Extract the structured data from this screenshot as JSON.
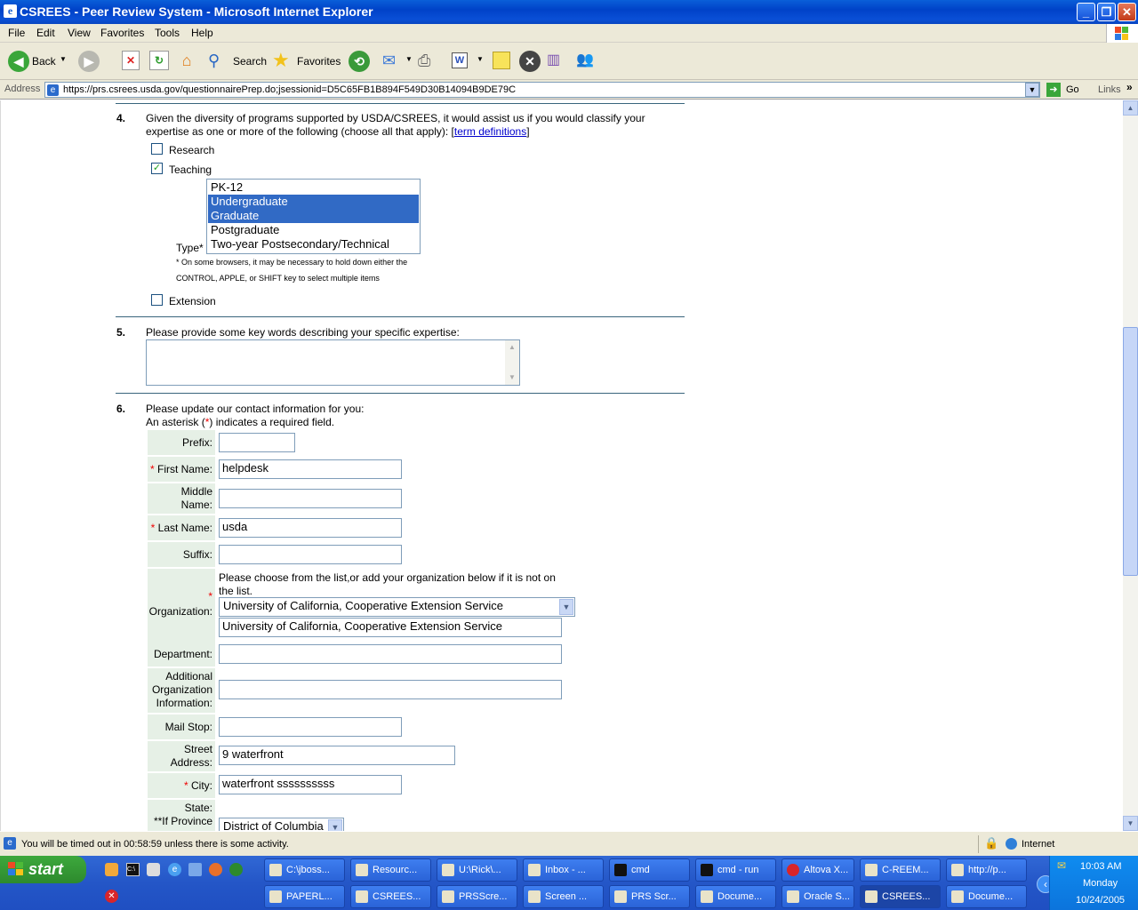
{
  "window": {
    "title": "CSREES - Peer Review System - Microsoft Internet Explorer",
    "app_icon_glyph": "e"
  },
  "menu": [
    "File",
    "Edit",
    "View",
    "Favorites",
    "Tools",
    "Help"
  ],
  "toolbar": {
    "back": "Back",
    "search": "Search",
    "favorites": "Favorites"
  },
  "address": {
    "label": "Address",
    "url": "https://prs.csrees.usda.gov/questionnairePrep.do;jsessionid=D5C65FB1B894F549D30B14094B9DE79C",
    "go": "Go",
    "links": "Links"
  },
  "q4": {
    "number": "4.",
    "text1": "Given the diversity of programs supported by USDA/CSREES, it would assist us if you would classify your",
    "text2": "expertise as one or more of the following (choose all that apply): [",
    "link": "term definitions",
    "text3": "]",
    "research": "Research",
    "teaching": "Teaching",
    "type_label": "Type*",
    "type_options": [
      "PK-12",
      "Undergraduate",
      "Graduate",
      "Postgraduate",
      "Two-year Postsecondary/Technical"
    ],
    "type_selected": [
      "Undergraduate",
      "Graduate"
    ],
    "note1": "* On some browsers, it may be necessary to hold down either the",
    "note2": "CONTROL, APPLE, or SHIFT key to select multiple items",
    "extension": "Extension"
  },
  "q5": {
    "number": "5.",
    "text": "Please provide some key words describing your specific expertise:",
    "value": ""
  },
  "q6": {
    "number": "6.",
    "text1": "Please update our contact information for you:",
    "text2a": "An asterisk (",
    "asterisk": "*",
    "text2b": ") indicates a required field.",
    "prefix_label": "Prefix:",
    "prefix": "",
    "first_label": "First Name:",
    "first": "helpdesk",
    "middle_label1": "Middle",
    "middle_label2": "Name:",
    "middle": "",
    "last_label": "Last Name:",
    "last": "usda",
    "suffix_label": "Suffix:",
    "suffix": "",
    "org_hint1": "Please choose from the list,or add your organization below if it is not on",
    "org_hint2": "the list.",
    "org_label": "Organization:",
    "org_select": "University of California, Cooperative Extension Service",
    "org_text": "University of California, Cooperative Extension Service",
    "dept_label": "Department:",
    "dept": "",
    "addl_label1": "Additional",
    "addl_label2": "Organization",
    "addl_label3": "Information:",
    "addl": "",
    "mail_label": "Mail Stop:",
    "mail": "",
    "street_label1": "Street",
    "street_label2": "Address:",
    "street": "9 waterfront",
    "city_label": "City:",
    "city": "waterfront ssssssssss",
    "state_label1": "State:",
    "state_label2": "**If Province",
    "state": "District of Columbia"
  },
  "status": {
    "text": "You will be timed out in 00:58:59 unless there is some activity.",
    "zone": "Internet"
  },
  "taskbar": {
    "start": "start",
    "row1": [
      "C:\\jboss...",
      "Resourc...",
      "U:\\Rick\\...",
      "Inbox - ...",
      "cmd",
      "cmd - run",
      "Altova X...",
      "C-REEM...",
      "http://p..."
    ],
    "row2": [
      "PAPERL...",
      "CSREES...",
      "PRSScre...",
      "Screen ...",
      "PRS Scr...",
      "Docume...",
      "Oracle S...",
      "CSREES...",
      "Docume..."
    ],
    "active_row2_index": 7
  },
  "clock": {
    "time": "10:03 AM",
    "day": "Monday",
    "date": "10/24/2005"
  },
  "colors": {
    "title_bar": "#0a4fd6",
    "selection": "#316ac5",
    "label_bg": "#e6f0e6",
    "required": "#e00000",
    "taskbar": "#2456c7"
  }
}
